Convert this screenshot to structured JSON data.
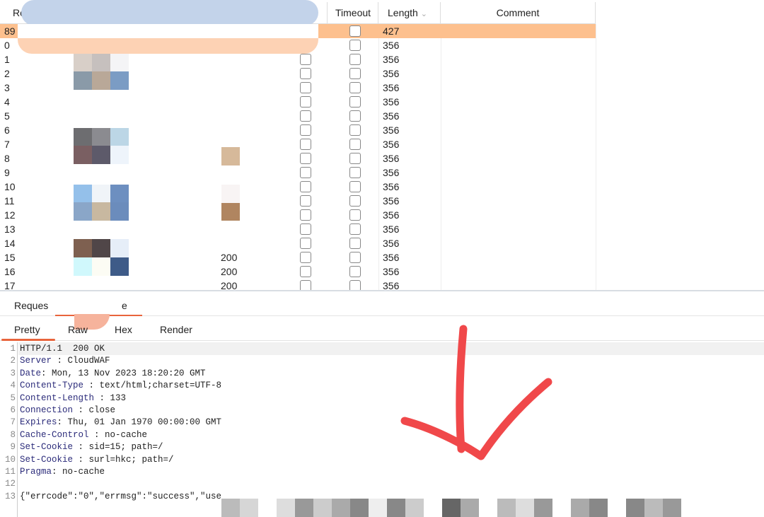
{
  "table": {
    "columns": {
      "request": "Re",
      "timeout": "Timeout",
      "length": "Length",
      "comment": "Comment"
    },
    "rows": [
      {
        "id": "89",
        "status": "",
        "length": "427",
        "selected": true
      },
      {
        "id": "0",
        "status": "",
        "length": "356"
      },
      {
        "id": "1",
        "status": "",
        "length": "356"
      },
      {
        "id": "2",
        "status": "",
        "length": "356"
      },
      {
        "id": "3",
        "status": "",
        "length": "356"
      },
      {
        "id": "4",
        "status": "",
        "length": "356"
      },
      {
        "id": "5",
        "status": "",
        "length": "356"
      },
      {
        "id": "6",
        "status": "",
        "length": "356"
      },
      {
        "id": "7",
        "status": "",
        "length": "356"
      },
      {
        "id": "8",
        "status": "",
        "length": "356"
      },
      {
        "id": "9",
        "status": "",
        "length": "356"
      },
      {
        "id": "10",
        "status": "",
        "length": "356"
      },
      {
        "id": "11",
        "status": "",
        "length": "356"
      },
      {
        "id": "12",
        "status": "",
        "length": "356"
      },
      {
        "id": "13",
        "status": "",
        "length": "356"
      },
      {
        "id": "14",
        "status": "",
        "length": "356"
      },
      {
        "id": "15",
        "status": "200",
        "length": "356"
      },
      {
        "id": "16",
        "status": "200",
        "length": "356"
      },
      {
        "id": "17",
        "status": "200",
        "length": "356"
      }
    ]
  },
  "tabs": {
    "request": "Reques",
    "response": "e"
  },
  "view_tabs": [
    "Pretty",
    "Raw",
    "Hex",
    "Render"
  ],
  "response_lines": [
    {
      "n": "1",
      "key": "",
      "text": "HTTP/1.1  200 OK"
    },
    {
      "n": "2",
      "key": "Server",
      "text": " : CloudWAF"
    },
    {
      "n": "3",
      "key": "Date",
      "text": ": Mon, 13 Nov 2023 18:20:20 GMT"
    },
    {
      "n": "4",
      "key": "Content-Type",
      "text": " : text/html;charset=UTF-8"
    },
    {
      "n": "5",
      "key": "Content-Length",
      "text": " : 133"
    },
    {
      "n": "6",
      "key": "Connection",
      "text": " : close"
    },
    {
      "n": "7",
      "key": "Expires",
      "text": ": Thu, 01 Jan 1970 00:00:00 GMT"
    },
    {
      "n": "8",
      "key": "Cache-Control",
      "text": " : no-cache"
    },
    {
      "n": "9",
      "key": "Set-Cookie",
      "text": " : sid=15; path=/"
    },
    {
      "n": "10",
      "key": "Set-Cookie",
      "text": " : surl=hkc; path=/"
    },
    {
      "n": "11",
      "key": "Pragma",
      "text": ": no-cache"
    },
    {
      "n": "12",
      "key": "",
      "text": ""
    },
    {
      "n": "13",
      "key": "",
      "text": "{\"errcode\":\"0\",\"errmsg\":\"success\",\"use"
    }
  ],
  "colors": {
    "selected_row": "#fdc08e",
    "accent": "#e8643c",
    "annotation_arrow": "#f0484a"
  },
  "icons": {
    "sort": "chevron-down-icon",
    "annotation": "red-arrow-down"
  }
}
